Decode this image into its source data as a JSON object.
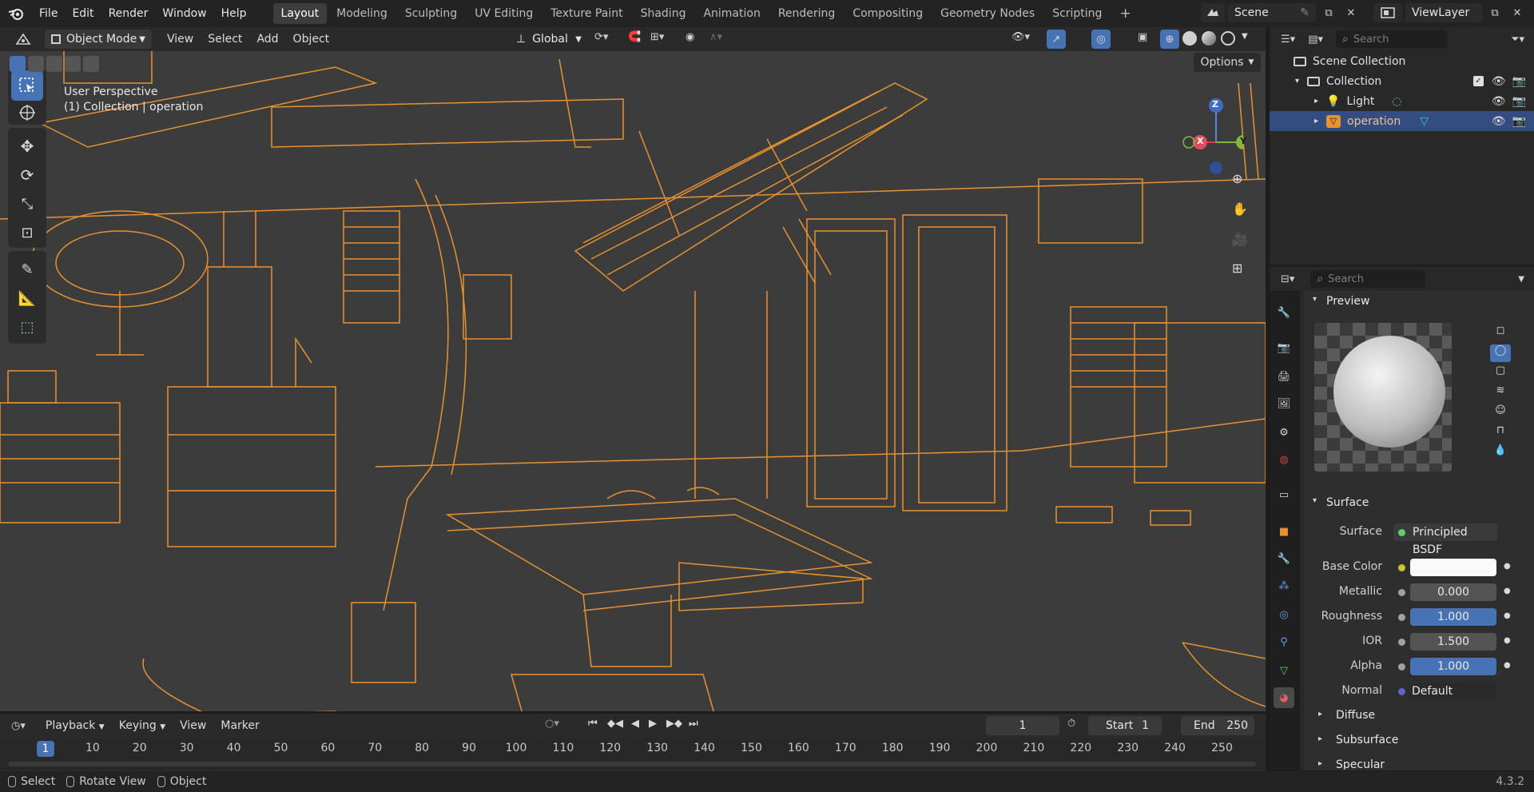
{
  "topbar": {
    "menus": [
      "File",
      "Edit",
      "Render",
      "Window",
      "Help"
    ],
    "workspaces": [
      "Layout",
      "Modeling",
      "Sculpting",
      "UV Editing",
      "Texture Paint",
      "Shading",
      "Animation",
      "Rendering",
      "Compositing",
      "Geometry Nodes",
      "Scripting"
    ],
    "active_workspace": "Layout",
    "add_workspace": "+",
    "scene": "Scene",
    "view_layer": "ViewLayer"
  },
  "viewport_header": {
    "mode": "Object Mode",
    "menus": [
      "View",
      "Select",
      "Add",
      "Object"
    ],
    "transform_orientation": "Global",
    "options": "Options"
  },
  "viewport": {
    "perspective": "User Perspective",
    "collection_info": "(1) Collection | operation",
    "gizmo": {
      "x": "X",
      "y": "Y",
      "z": "Z"
    }
  },
  "outliner": {
    "search_placeholder": "Search",
    "root": "Scene Collection",
    "collection": "Collection",
    "items": [
      {
        "name": "Light"
      },
      {
        "name": "operation"
      }
    ]
  },
  "properties": {
    "search_placeholder": "Search",
    "preview_label": "Preview",
    "surface_section": "Surface",
    "surface_shader_label": "Surface",
    "surface_shader": "Principled BSDF",
    "fields": [
      {
        "label": "Base Color",
        "value": ""
      },
      {
        "label": "Metallic",
        "value": "0.000"
      },
      {
        "label": "Roughness",
        "value": "1.000"
      },
      {
        "label": "IOR",
        "value": "1.500"
      },
      {
        "label": "Alpha",
        "value": "1.000"
      },
      {
        "label": "Normal",
        "value": "Default"
      }
    ],
    "subsections": [
      "Diffuse",
      "Subsurface",
      "Specular"
    ]
  },
  "timeline": {
    "menus": [
      "Playback",
      "Keying",
      "View",
      "Marker"
    ],
    "current_frame": "1",
    "start_label": "Start",
    "start": "1",
    "end_label": "End",
    "end": "250",
    "ticks": [
      "10",
      "20",
      "30",
      "40",
      "50",
      "60",
      "70",
      "80",
      "90",
      "100",
      "110",
      "120",
      "130",
      "140",
      "150",
      "160",
      "170",
      "180",
      "190",
      "200",
      "210",
      "220",
      "230",
      "240",
      "250"
    ],
    "playhead": "1"
  },
  "statusbar": {
    "hints": [
      "Select",
      "Rotate View",
      "Object"
    ],
    "version": "4.3.2"
  },
  "colors": {
    "accent": "#4772b3",
    "wire": "#e8912f",
    "viewport_bg": "#3c3c3c"
  }
}
